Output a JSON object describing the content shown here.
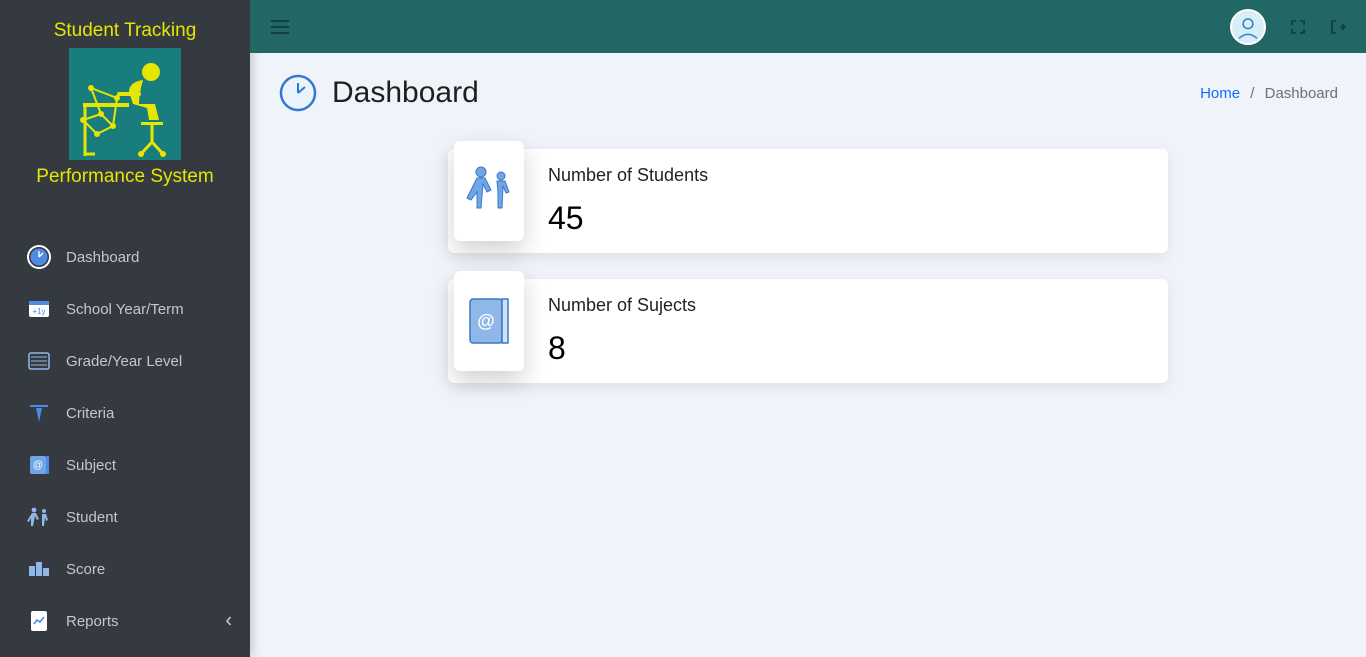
{
  "brand": {
    "top": "Student Tracking",
    "bottom": "Performance System"
  },
  "sidebar": {
    "items": [
      {
        "label": "Dashboard"
      },
      {
        "label": "School Year/Term"
      },
      {
        "label": "Grade/Year Level"
      },
      {
        "label": "Criteria"
      },
      {
        "label": "Subject"
      },
      {
        "label": "Student"
      },
      {
        "label": "Score"
      },
      {
        "label": "Reports"
      }
    ]
  },
  "page": {
    "title": "Dashboard"
  },
  "breadcrumb": {
    "home": "Home",
    "sep": "/",
    "current": "Dashboard"
  },
  "stats": {
    "students": {
      "label": "Number of Students",
      "value": "45"
    },
    "subjects": {
      "label": "Number of Sujects",
      "value": "8"
    }
  }
}
